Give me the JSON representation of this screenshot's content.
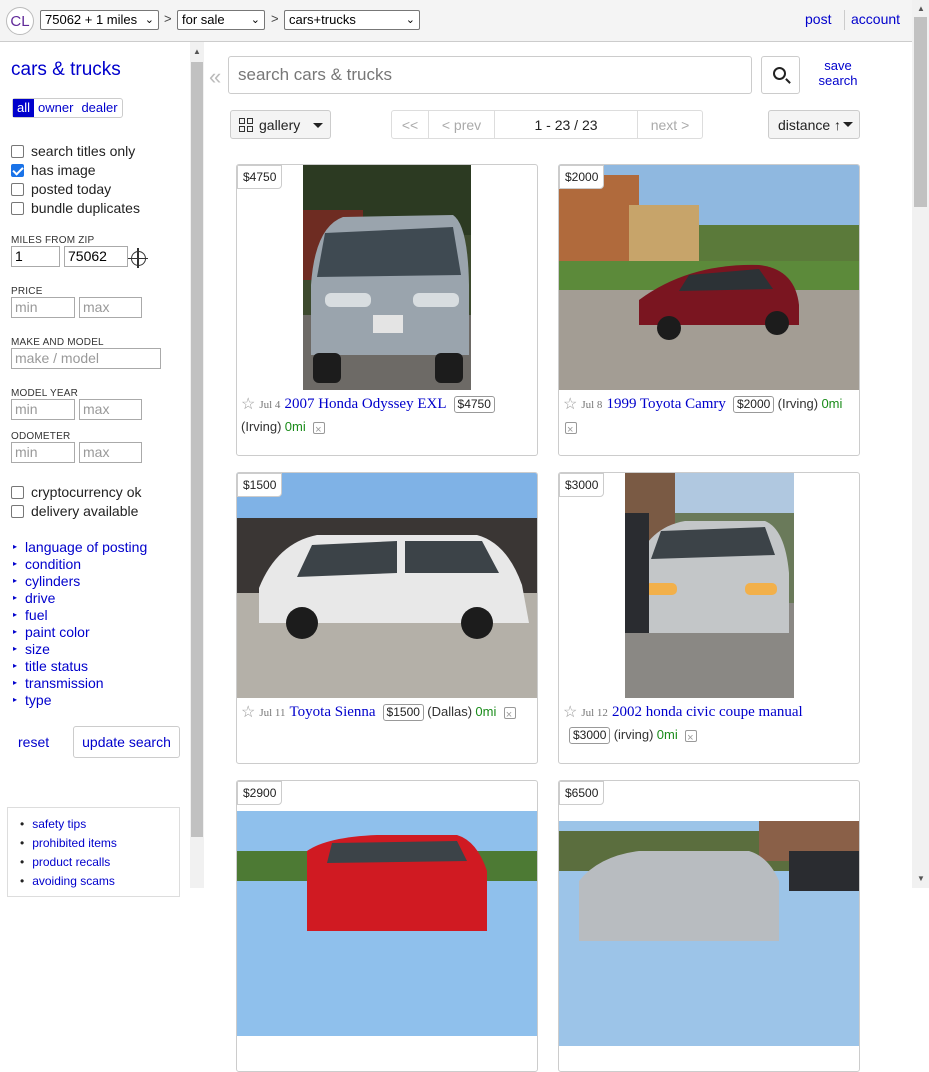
{
  "header": {
    "logo": "CL",
    "area_select": "75062 + 1 miles",
    "type_select": "for sale",
    "category_select": "cars+trucks",
    "sep": ">",
    "post": "post",
    "account": "account"
  },
  "sidebar": {
    "title": "cars & trucks",
    "seller_tabs": [
      "all",
      "owner",
      "dealer"
    ],
    "checkboxes": [
      {
        "label": "search titles only",
        "checked": false
      },
      {
        "label": "has image",
        "checked": true
      },
      {
        "label": "posted today",
        "checked": false
      },
      {
        "label": "bundle duplicates",
        "checked": false
      }
    ],
    "miles_label": "MILES FROM ZIP",
    "miles_value": "1",
    "zip_value": "75062",
    "price_label": "PRICE",
    "min_ph": "min",
    "max_ph": "max",
    "make_label": "MAKE AND MODEL",
    "make_ph": "make / model",
    "year_label": "MODEL YEAR",
    "odometer_label": "ODOMETER",
    "extra_checkboxes": [
      {
        "label": "cryptocurrency ok",
        "checked": false
      },
      {
        "label": "delivery available",
        "checked": false
      }
    ],
    "filters": [
      "language of posting",
      "condition",
      "cylinders",
      "drive",
      "fuel",
      "paint color",
      "size",
      "title status",
      "transmission",
      "type"
    ],
    "reset": "reset",
    "update": "update search",
    "help_links": [
      "safety tips",
      "prohibited items",
      "product recalls",
      "avoiding scams"
    ]
  },
  "main": {
    "collapse": "«",
    "search_ph": "search cars & trucks",
    "save_search": "save search",
    "view": "gallery",
    "pager": {
      "first": "<<",
      "prev": "< prev",
      "range": "1 - 23 / 23",
      "next": "next >"
    },
    "sort": "distance ↑"
  },
  "listings": [
    {
      "price": "$4750",
      "date": "Jul 4",
      "title": "2007 Honda Odyssey EXL",
      "loc": "(Irving)",
      "dist": "0mi",
      "car_color": "#9aa4ad"
    },
    {
      "price": "$2000",
      "date": "Jul 8",
      "title": "1999 Toyota Camry",
      "loc": "(Irving)",
      "dist": "0mi",
      "car_color": "#7a1520"
    },
    {
      "price": "$1500",
      "date": "Jul 11",
      "title": "Toyota Sienna",
      "loc": "(Dallas)",
      "dist": "0mi",
      "car_color": "#e8e8e8"
    },
    {
      "price": "$3000",
      "date": "Jul 12",
      "title": "2002 honda civic coupe manual",
      "loc": "(irving)",
      "dist": "0mi",
      "car_color": "#c3c6c8"
    },
    {
      "price": "$2900",
      "car_color": "#d01a22"
    },
    {
      "price": "$6500",
      "car_color": "#b8bcc0"
    }
  ]
}
